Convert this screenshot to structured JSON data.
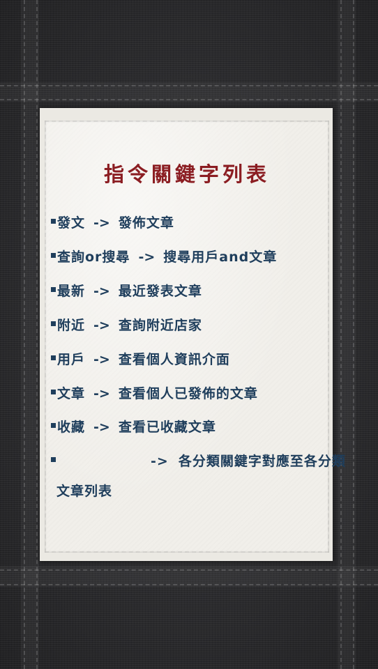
{
  "title": "指令關鍵字列表",
  "arrow": "->",
  "commands": [
    {
      "keyword": "發文",
      "description": "發佈文章"
    },
    {
      "keyword": "查詢or搜尋",
      "description": "搜尋用戶and文章"
    },
    {
      "keyword": "最新",
      "description": "最近發表文章"
    },
    {
      "keyword": "附近",
      "description": "查詢附近店家"
    },
    {
      "keyword": "用戶",
      "description": "查看個人資訊介面"
    },
    {
      "keyword": "文章",
      "description": "查看個人已發佈的文章"
    },
    {
      "keyword": "收藏",
      "description": "查看已收藏文章"
    }
  ],
  "category_command": {
    "keyword": "",
    "description_line1": "各分類關鍵字對應至各分類",
    "description_line2": "文章列表"
  },
  "colors": {
    "title": "#8b1d22",
    "text": "#1f3e5c",
    "paper": "#f1efea",
    "background": "#2a2a2c"
  }
}
